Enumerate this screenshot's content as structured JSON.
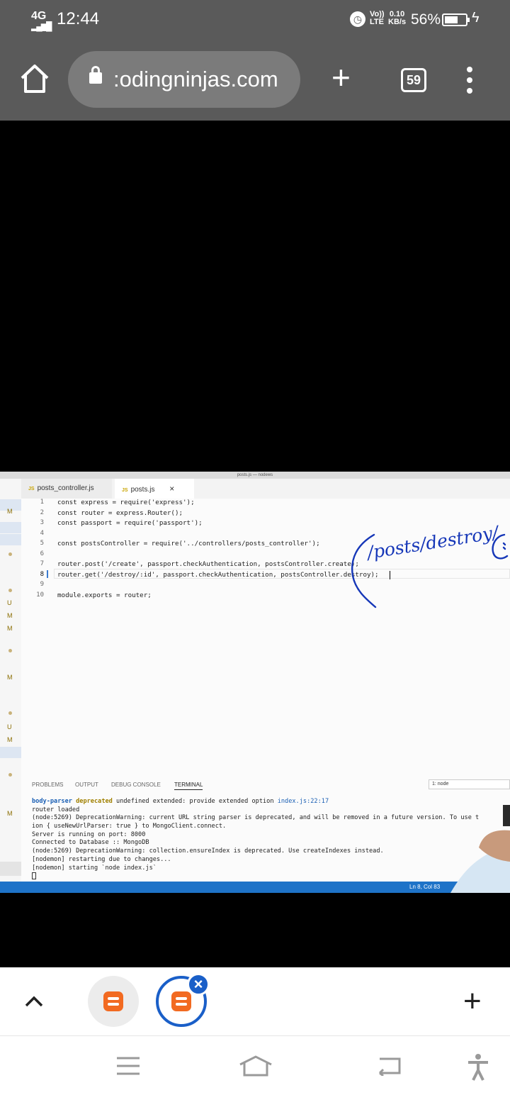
{
  "status_bar": {
    "network": "4G",
    "time": "12:44",
    "volte_top": "Vo))",
    "volte_bottom": "LTE",
    "speed_value": "0.10",
    "speed_unit": "KB/s",
    "battery_percent": "56%"
  },
  "browser": {
    "url": ":odingninjas.com",
    "tab_count": "59"
  },
  "vscode": {
    "window_title": "posts.js — nodews",
    "tabs": [
      {
        "icon": "JS",
        "label": "posts_controller.js"
      },
      {
        "icon": "JS",
        "label": "posts.js",
        "close": "×"
      }
    ],
    "gutter_markers": [
      "M",
      "U",
      "M",
      "M",
      "M",
      "U",
      "M",
      "M"
    ],
    "line_numbers": [
      "1",
      "2",
      "3",
      "4",
      "5",
      "6",
      "7",
      "8",
      "9",
      "10"
    ],
    "code": [
      "const express = require('express');",
      "const router = express.Router();",
      "const passport = require('passport');",
      "",
      "const postsController = require('../controllers/posts_controller');",
      "",
      "router.post('/create', passport.checkAuthentication, postsController.create);",
      "router.get('/destroy/:id', passport.checkAuthentication, postsController.destroy);",
      "",
      "module.exports = router;"
    ],
    "panel_tabs": [
      "PROBLEMS",
      "OUTPUT",
      "DEBUG CONSOLE",
      "TERMINAL"
    ],
    "terminal_select": "1: node",
    "terminal": {
      "first_line": {
        "pkg": "body-parser",
        "word": "deprecated",
        "rest": " undefined extended: provide extended option ",
        "link": "index.js:22:17"
      },
      "lines": [
        "router loaded",
        "(node:5269) DeprecationWarning: current URL string parser is deprecated, and will be removed in a future version. To use t",
        "ion { useNewUrlParser: true } to MongoClient.connect.",
        "Server is running on port: 8000",
        "Connected to Database :: MongoDB",
        "(node:5269) DeprecationWarning: collection.ensureIndex is deprecated. Use createIndexes instead."
      ],
      "nodemon_lines": [
        "[nodemon] restarting due to changes...",
        "[nodemon] starting `node index.js`"
      ]
    },
    "cursor_position": "Ln 8, Col 83"
  },
  "annotation": {
    "handwriting": "/posts/destroy/"
  },
  "colors": {
    "chrome_bg": "#5a5a5a",
    "accent_blue": "#1e73c8",
    "ink_blue": "#1637b8",
    "coding_ninjas_orange": "#f26a21"
  }
}
